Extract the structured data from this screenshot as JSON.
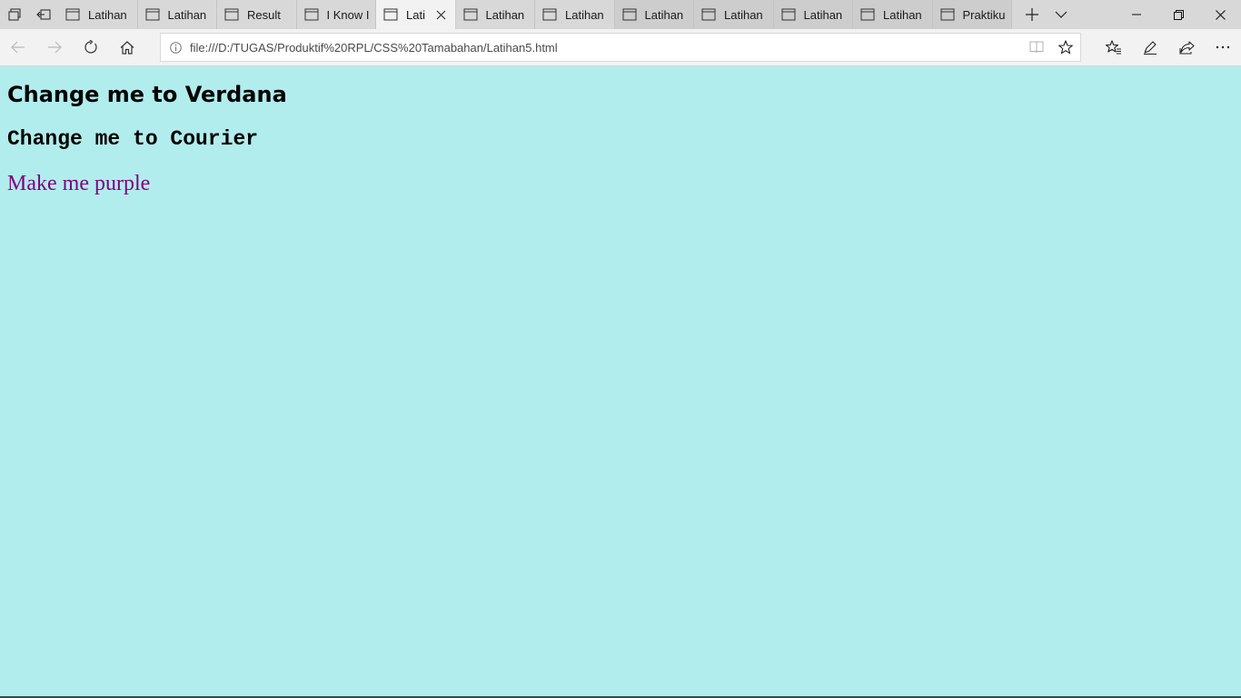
{
  "browser": {
    "tabs": [
      {
        "title": "Latihan",
        "active": false
      },
      {
        "title": "Latihan",
        "active": false
      },
      {
        "title": "Result",
        "active": false
      },
      {
        "title": "I Know I",
        "active": false
      },
      {
        "title": "Lati",
        "active": true
      },
      {
        "title": "Latihan",
        "active": false
      },
      {
        "title": "Latihan",
        "active": false
      },
      {
        "title": "Latihan",
        "active": false
      },
      {
        "title": "Latihan",
        "active": false
      },
      {
        "title": "Latihan",
        "active": false
      },
      {
        "title": "Latihan",
        "active": false
      },
      {
        "title": "Praktiku",
        "active": false
      }
    ],
    "address": {
      "url": "file:///D:/TUGAS/Produktif%20RPL/CSS%20Tamabahan/Latihan5.html"
    }
  },
  "page": {
    "heading_verdana": "Change me to Verdana",
    "heading_courier": "Change me to Courier",
    "paragraph_purple": "Make me purple",
    "background_color": "#b2eded",
    "purple_color": "#800080"
  },
  "icons": {
    "tab_preview": "tab-preview-icon",
    "set_aside": "set-aside-tabs-icon",
    "page": "page-icon",
    "close": "close-icon",
    "new_tab": "plus-icon",
    "tab_menu": "chevron-down-icon",
    "back": "back-arrow-icon",
    "forward": "forward-arrow-icon",
    "refresh": "refresh-icon",
    "home": "home-icon",
    "info": "info-icon",
    "reading_view": "reading-view-icon",
    "favorite": "star-icon",
    "favorites_hub": "favorites-hub-icon",
    "web_note": "pen-icon",
    "share": "share-icon",
    "more": "more-icon"
  }
}
